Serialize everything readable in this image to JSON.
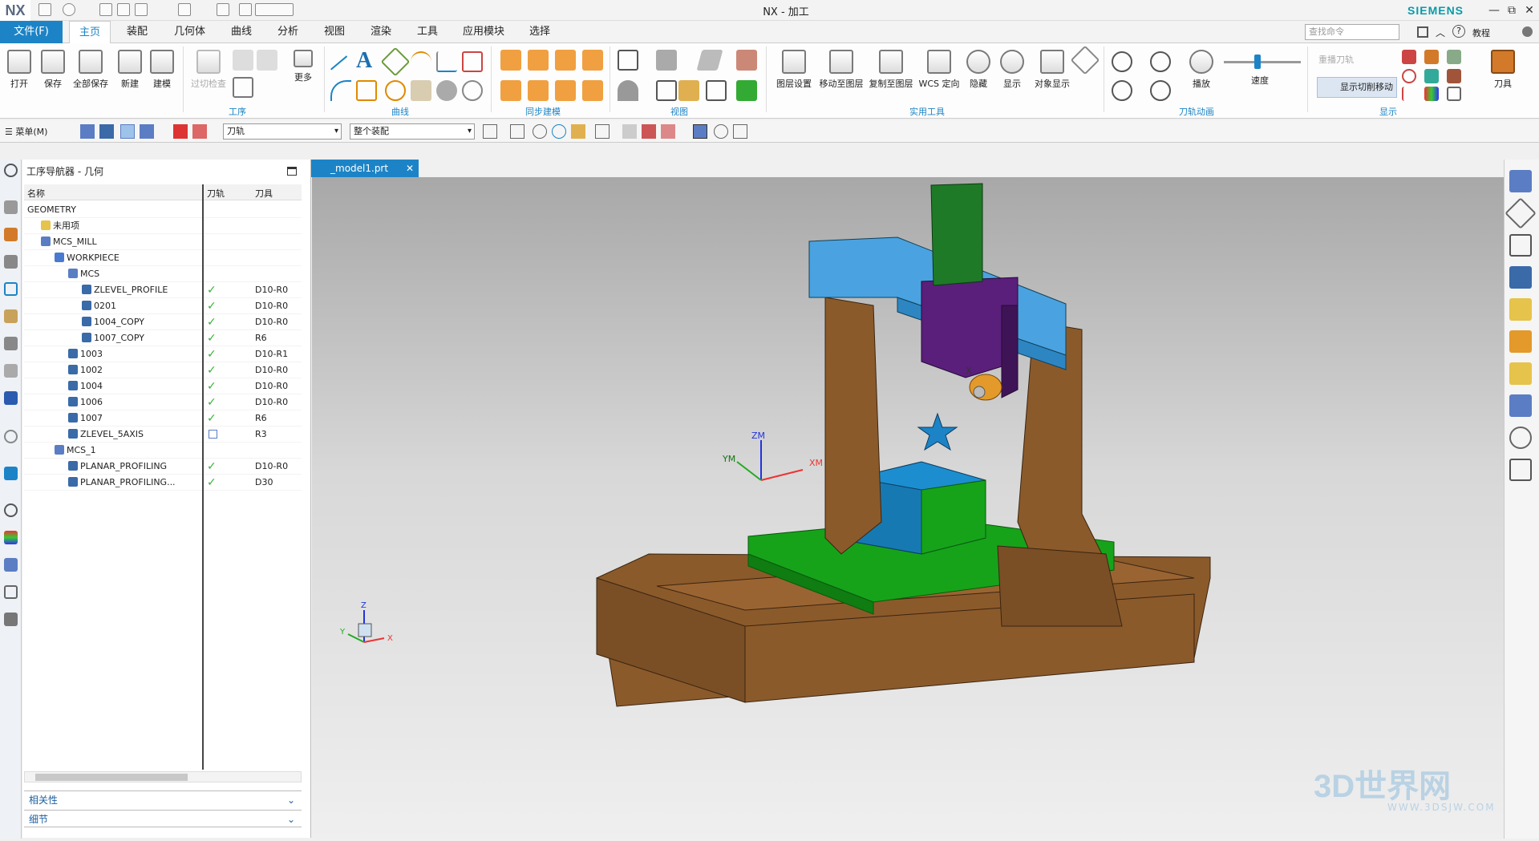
{
  "app": {
    "logo": "NX",
    "title": "NX - 加工",
    "brand": "SIEMENS",
    "window_controls": [
      "—",
      "⧉",
      "✕"
    ]
  },
  "menu": {
    "file": "文件(F)",
    "tabs": [
      "主页",
      "装配",
      "几何体",
      "曲线",
      "分析",
      "视图",
      "渲染",
      "工具",
      "应用模块",
      "选择"
    ],
    "search_placeholder": "查找命令",
    "tutorial": "教程"
  },
  "ribbon": {
    "buttons": [
      "打开",
      "保存",
      "全部保存",
      "新建",
      "建模",
      "过切检查",
      "更多",
      "图层设置",
      "移动至图层",
      "复制至图层",
      "WCS 定向",
      "隐藏",
      "显示",
      "对象显示",
      "播放",
      "速度",
      "重播刀轨",
      "显示切削移动",
      "刀具"
    ],
    "groups": [
      "工序",
      "曲线",
      "同步建模",
      "视图",
      "实用工具",
      "刀轨动画",
      "显示"
    ]
  },
  "toolbar2": {
    "menu_label": "菜单(M)",
    "filter_type": "刀轨",
    "filter_scope": "整个装配"
  },
  "navigator": {
    "title": "工序导航器 - 几何",
    "columns": [
      "名称",
      "刀轨",
      "刀具"
    ],
    "rows": [
      {
        "name": "GEOMETRY",
        "indent": 0,
        "icon": "",
        "check": "",
        "tool": ""
      },
      {
        "name": "未用项",
        "indent": 1,
        "icon": "folder",
        "check": "",
        "tool": ""
      },
      {
        "name": "MCS_MILL",
        "indent": 1,
        "icon": "mcs",
        "check": "",
        "tool": ""
      },
      {
        "name": "WORKPIECE",
        "indent": 2,
        "icon": "workpiece",
        "check": "",
        "tool": ""
      },
      {
        "name": "MCS",
        "indent": 3,
        "icon": "mcs",
        "check": "",
        "tool": ""
      },
      {
        "name": "ZLEVEL_PROFILE",
        "indent": 4,
        "icon": "op",
        "check": "ok",
        "tool": "D10-R0"
      },
      {
        "name": "0201",
        "indent": 4,
        "icon": "op",
        "check": "ok",
        "tool": "D10-R0"
      },
      {
        "name": "1004_COPY",
        "indent": 4,
        "icon": "op",
        "check": "ok",
        "tool": "D10-R0"
      },
      {
        "name": "1007_COPY",
        "indent": 4,
        "icon": "op",
        "check": "ok",
        "tool": "R6"
      },
      {
        "name": "1003",
        "indent": 3,
        "icon": "op",
        "check": "ok",
        "tool": "D10-R1"
      },
      {
        "name": "1002",
        "indent": 3,
        "icon": "op",
        "check": "ok",
        "tool": "D10-R0"
      },
      {
        "name": "1004",
        "indent": 3,
        "icon": "op",
        "check": "ok",
        "tool": "D10-R0"
      },
      {
        "name": "1006",
        "indent": 3,
        "icon": "op",
        "check": "ok",
        "tool": "D10-R0"
      },
      {
        "name": "1007",
        "indent": 3,
        "icon": "op",
        "check": "ok",
        "tool": "R6"
      },
      {
        "name": "ZLEVEL_5AXIS",
        "indent": 3,
        "icon": "op",
        "check": "box",
        "tool": "R3"
      },
      {
        "name": "MCS_1",
        "indent": 2,
        "icon": "mcs",
        "check": "",
        "tool": ""
      },
      {
        "name": "PLANAR_PROFILING",
        "indent": 3,
        "icon": "op",
        "check": "ok",
        "tool": "D10-R0"
      },
      {
        "name": "PLANAR_PROFILING...",
        "indent": 3,
        "icon": "op",
        "check": "ok",
        "tool": "D30"
      }
    ],
    "accordion": [
      "相关性",
      "细节"
    ]
  },
  "document": {
    "tab": "_model1.prt"
  },
  "viewport": {
    "axis_labels": {
      "zm": "ZM",
      "ym": "YM",
      "xm": "XM",
      "x": "X",
      "y": "Y",
      "z": "Z"
    }
  },
  "watermark": {
    "main": "3D世界网",
    "sub": "WWW.3DSJW.COM"
  },
  "colors": {
    "accent": "#1c84c6",
    "wood": "#8b5a2b",
    "wood_dark": "#6b4020",
    "table": "#16a31a",
    "beam": "#4aa3e0",
    "head": "#5a1f7a",
    "spindle": "#1f7a27",
    "stock": "#1c8ecf",
    "check": "#3bb03b"
  }
}
